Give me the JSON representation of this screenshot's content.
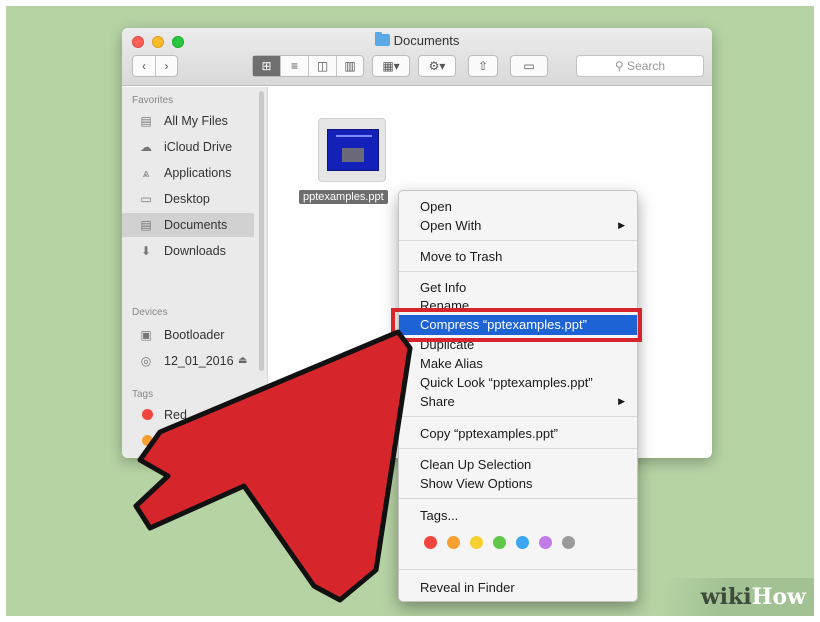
{
  "window": {
    "title": "Documents",
    "view_buttons": [
      "⊞",
      "≡",
      "◫",
      "▥"
    ],
    "search_placeholder": "Search"
  },
  "sidebar": {
    "favorites_heading": "Favorites",
    "favorites": [
      {
        "label": "All My Files",
        "icon": "all-files-icon",
        "glyph": "▤"
      },
      {
        "label": "iCloud Drive",
        "icon": "cloud-icon",
        "glyph": "☁"
      },
      {
        "label": "Applications",
        "icon": "applications-icon",
        "glyph": "⩓"
      },
      {
        "label": "Desktop",
        "icon": "desktop-icon",
        "glyph": "▭"
      },
      {
        "label": "Documents",
        "icon": "documents-icon",
        "glyph": "▤",
        "selected": true
      },
      {
        "label": "Downloads",
        "icon": "downloads-icon",
        "glyph": "⬇"
      }
    ],
    "devices_heading": "Devices",
    "devices": [
      {
        "label": "Bootloader",
        "icon": "disk-icon",
        "glyph": "▣"
      },
      {
        "label": "12_01_2016",
        "icon": "optical-disc-icon",
        "glyph": "◎",
        "eject": "⏏"
      }
    ],
    "tags_heading": "Tags",
    "tags": [
      {
        "label": "Red",
        "color": "#f2453d"
      },
      {
        "label": "Orange",
        "color": "#f7a031"
      }
    ]
  },
  "file": {
    "name": "pptexamples.ppt"
  },
  "context_menu": {
    "open": "Open",
    "open_with": "Open With",
    "move_to_trash": "Move to Trash",
    "get_info": "Get Info",
    "rename": "Rename",
    "compress": "Compress “pptexamples.ppt”",
    "duplicate": "Duplicate",
    "make_alias": "Make Alias",
    "quick_look": "Quick Look “pptexamples.ppt”",
    "share": "Share",
    "copy": "Copy “pptexamples.ppt”",
    "clean_up_selection": "Clean Up Selection",
    "show_view_options": "Show View Options",
    "tags": "Tags...",
    "tag_colors": [
      "#f2453d",
      "#f7a031",
      "#f6cf33",
      "#5fc84a",
      "#3ba6f2",
      "#c27ce6",
      "#9a9a9a"
    ],
    "reveal_in_finder": "Reveal in Finder",
    "submenu_arrow": "▶"
  },
  "watermark": {
    "part1": "wiki",
    "part2": "How"
  },
  "colors": {
    "highlight": "#1d63d6",
    "arrow_red": "#d7262b",
    "background": "#b5d3a3"
  }
}
